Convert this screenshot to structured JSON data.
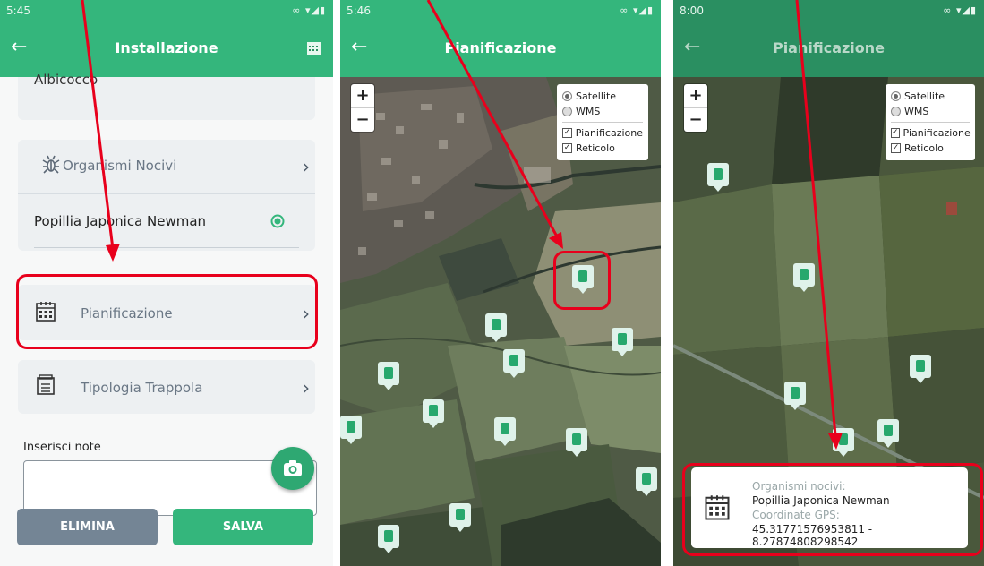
{
  "screen1": {
    "status_time": "5:45",
    "title": "Installazione",
    "prev_value": "Albicocco",
    "organismi_label": "Organismi Nocivi",
    "species": "Popillia Japonica Newman",
    "pianificazione_label": "Pianificazione",
    "tipologia_label": "Tipologia Trappola",
    "notes_label": "Inserisci note",
    "elimina_label": "ELIMINA",
    "salva_label": "SALVA"
  },
  "screen2": {
    "status_time": "5:46",
    "title": "Pianificazione",
    "zoom_in": "+",
    "zoom_out": "−",
    "layers": {
      "satellite": "Satellite",
      "wms": "WMS",
      "pianificazione": "Pianificazione",
      "reticolo": "Reticolo"
    }
  },
  "screen3": {
    "status_time": "8:00",
    "title": "Pianificazione",
    "zoom_in": "+",
    "zoom_out": "−",
    "layers": {
      "satellite": "Satellite",
      "wms": "WMS",
      "pianificazione": "Pianificazione",
      "reticolo": "Reticolo"
    },
    "popup": {
      "organismi_label": "Organismi nocivi:",
      "organismi_value": "Popillia Japonica Newman",
      "gps_label": "Coordinate GPS:",
      "gps_value": "45.31771576953811 - 8.27874808298542"
    }
  },
  "colors": {
    "primary": "#34b67c",
    "primary_dark": "#2a8f61",
    "highlight": "#e8001c",
    "elimina": "#748595"
  }
}
